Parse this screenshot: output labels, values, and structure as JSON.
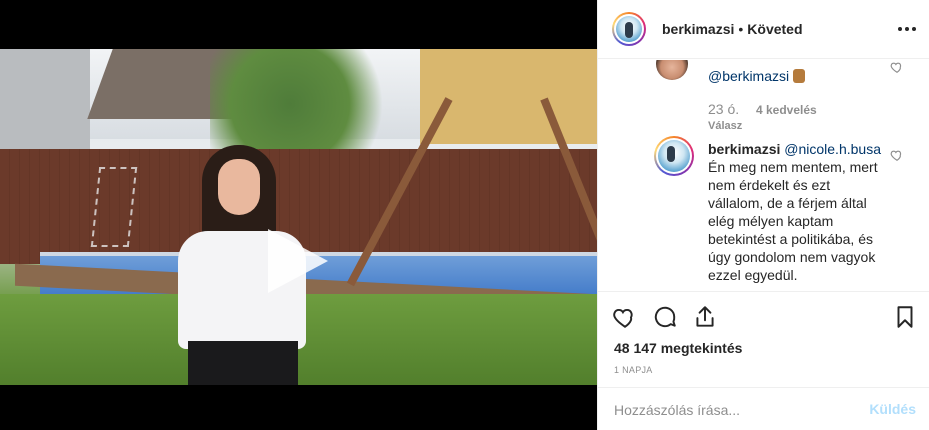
{
  "header": {
    "username": "berkimazsi",
    "separator": "•",
    "follow_status": "Követed"
  },
  "comments": {
    "previous": {
      "mention": "@berkimazsi",
      "emoji": "thumbs-down",
      "time": "23 ó.",
      "likes": "4 kedvelés",
      "reply_label": "Válasz"
    },
    "reply": {
      "username": "berkimazsi",
      "mention": "@nicole.h.busa",
      "text": "Én meg nem mentem, mert nem érdekelt és ezt vállalom, de a férjem által elég mélyen kaptam betekintést a politikába, és úgy gondolom nem vagyok ezzel egyedül."
    }
  },
  "actions": {
    "icons": [
      "heart-icon",
      "comment-icon",
      "share-icon",
      "bookmark-icon"
    ],
    "views": "48 147 megtekintés",
    "posted": "1 NAPJA"
  },
  "composer": {
    "placeholder": "Hozzászólás írása...",
    "send_label": "Küldés"
  },
  "colors": {
    "link": "#003569",
    "muted": "#8e8e8e",
    "send_disabled": "#b2dffc",
    "text": "#262626"
  }
}
